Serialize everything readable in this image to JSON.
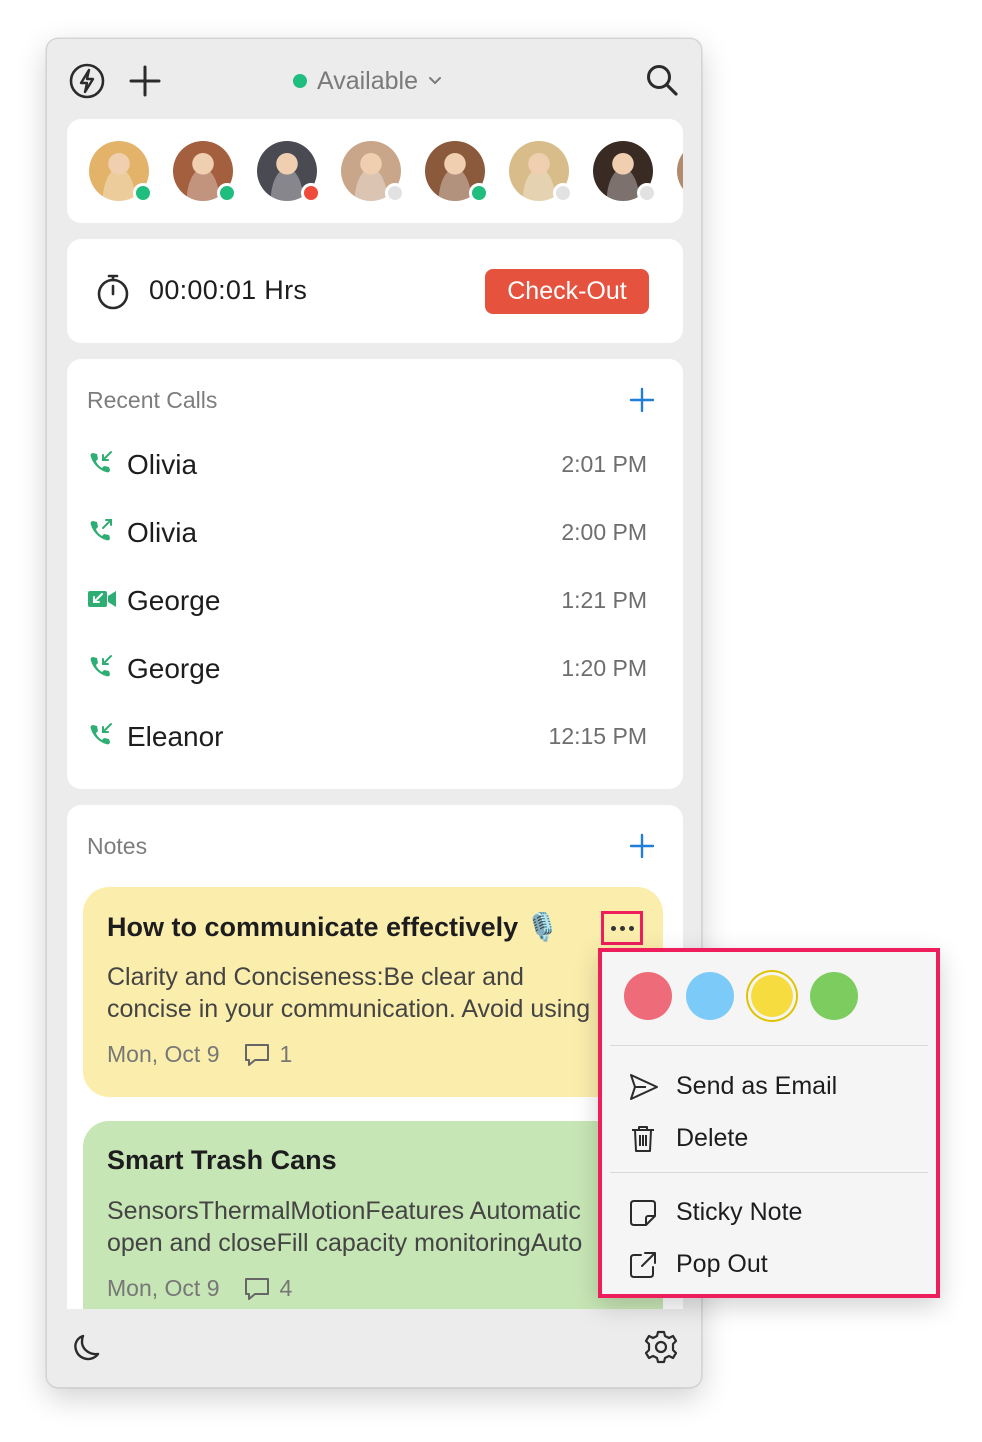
{
  "header": {
    "status": "Available",
    "status_color": "#1fbd7e"
  },
  "team_avatars": [
    {
      "name": "team-member-1",
      "presence": "online",
      "bg": "#e4b36a"
    },
    {
      "name": "team-member-2",
      "presence": "online",
      "bg": "#a45f3e"
    },
    {
      "name": "team-member-3",
      "presence": "busy",
      "bg": "#4a4a52"
    },
    {
      "name": "team-member-4",
      "presence": "offline",
      "bg": "#c9a68a"
    },
    {
      "name": "team-member-5",
      "presence": "online",
      "bg": "#8b5a3c"
    },
    {
      "name": "team-member-6",
      "presence": "offline",
      "bg": "#d8bc8a"
    },
    {
      "name": "team-member-7",
      "presence": "offline",
      "bg": "#3a2a24"
    }
  ],
  "timer": {
    "elapsed": "00:00:01 Hrs",
    "checkout_label": "Check-Out"
  },
  "recent_calls": {
    "title": "Recent Calls",
    "items": [
      {
        "name": "Olivia",
        "time": "2:01 PM",
        "type": "incoming"
      },
      {
        "name": "Olivia",
        "time": "2:00 PM",
        "type": "outgoing"
      },
      {
        "name": "George",
        "time": "1:21 PM",
        "type": "video"
      },
      {
        "name": "George",
        "time": "1:20 PM",
        "type": "incoming"
      },
      {
        "name": "Eleanor",
        "time": "12:15 PM",
        "type": "incoming"
      }
    ]
  },
  "notes": {
    "title": "Notes",
    "items": [
      {
        "title": "How to communicate effectively 🎙️",
        "body_line1": "Clarity and Conciseness:Be clear and",
        "body_line2": "concise in your communication. Avoid using",
        "date": "Mon, Oct 9",
        "comments": "1",
        "color": "#fbeeac"
      },
      {
        "title": "Smart Trash Cans",
        "body_line1": "SensorsThermalMotionFeatures Automatic",
        "body_line2": "open and closeFill capacity monitoringAuto",
        "date": "Mon, Oct 9",
        "comments": "4",
        "color": "#c7e6b5"
      }
    ]
  },
  "context_menu": {
    "colors": [
      "#ee6b7a",
      "#7ccaf7",
      "#f7dc3f",
      "#7ccc5f"
    ],
    "send_email": "Send as Email",
    "delete": "Delete",
    "sticky_note": "Sticky Note",
    "pop_out": "Pop Out"
  },
  "presence_colors": {
    "online": "#1fbd7e",
    "busy": "#ef4a3a",
    "offline": "#e2e2e2"
  }
}
